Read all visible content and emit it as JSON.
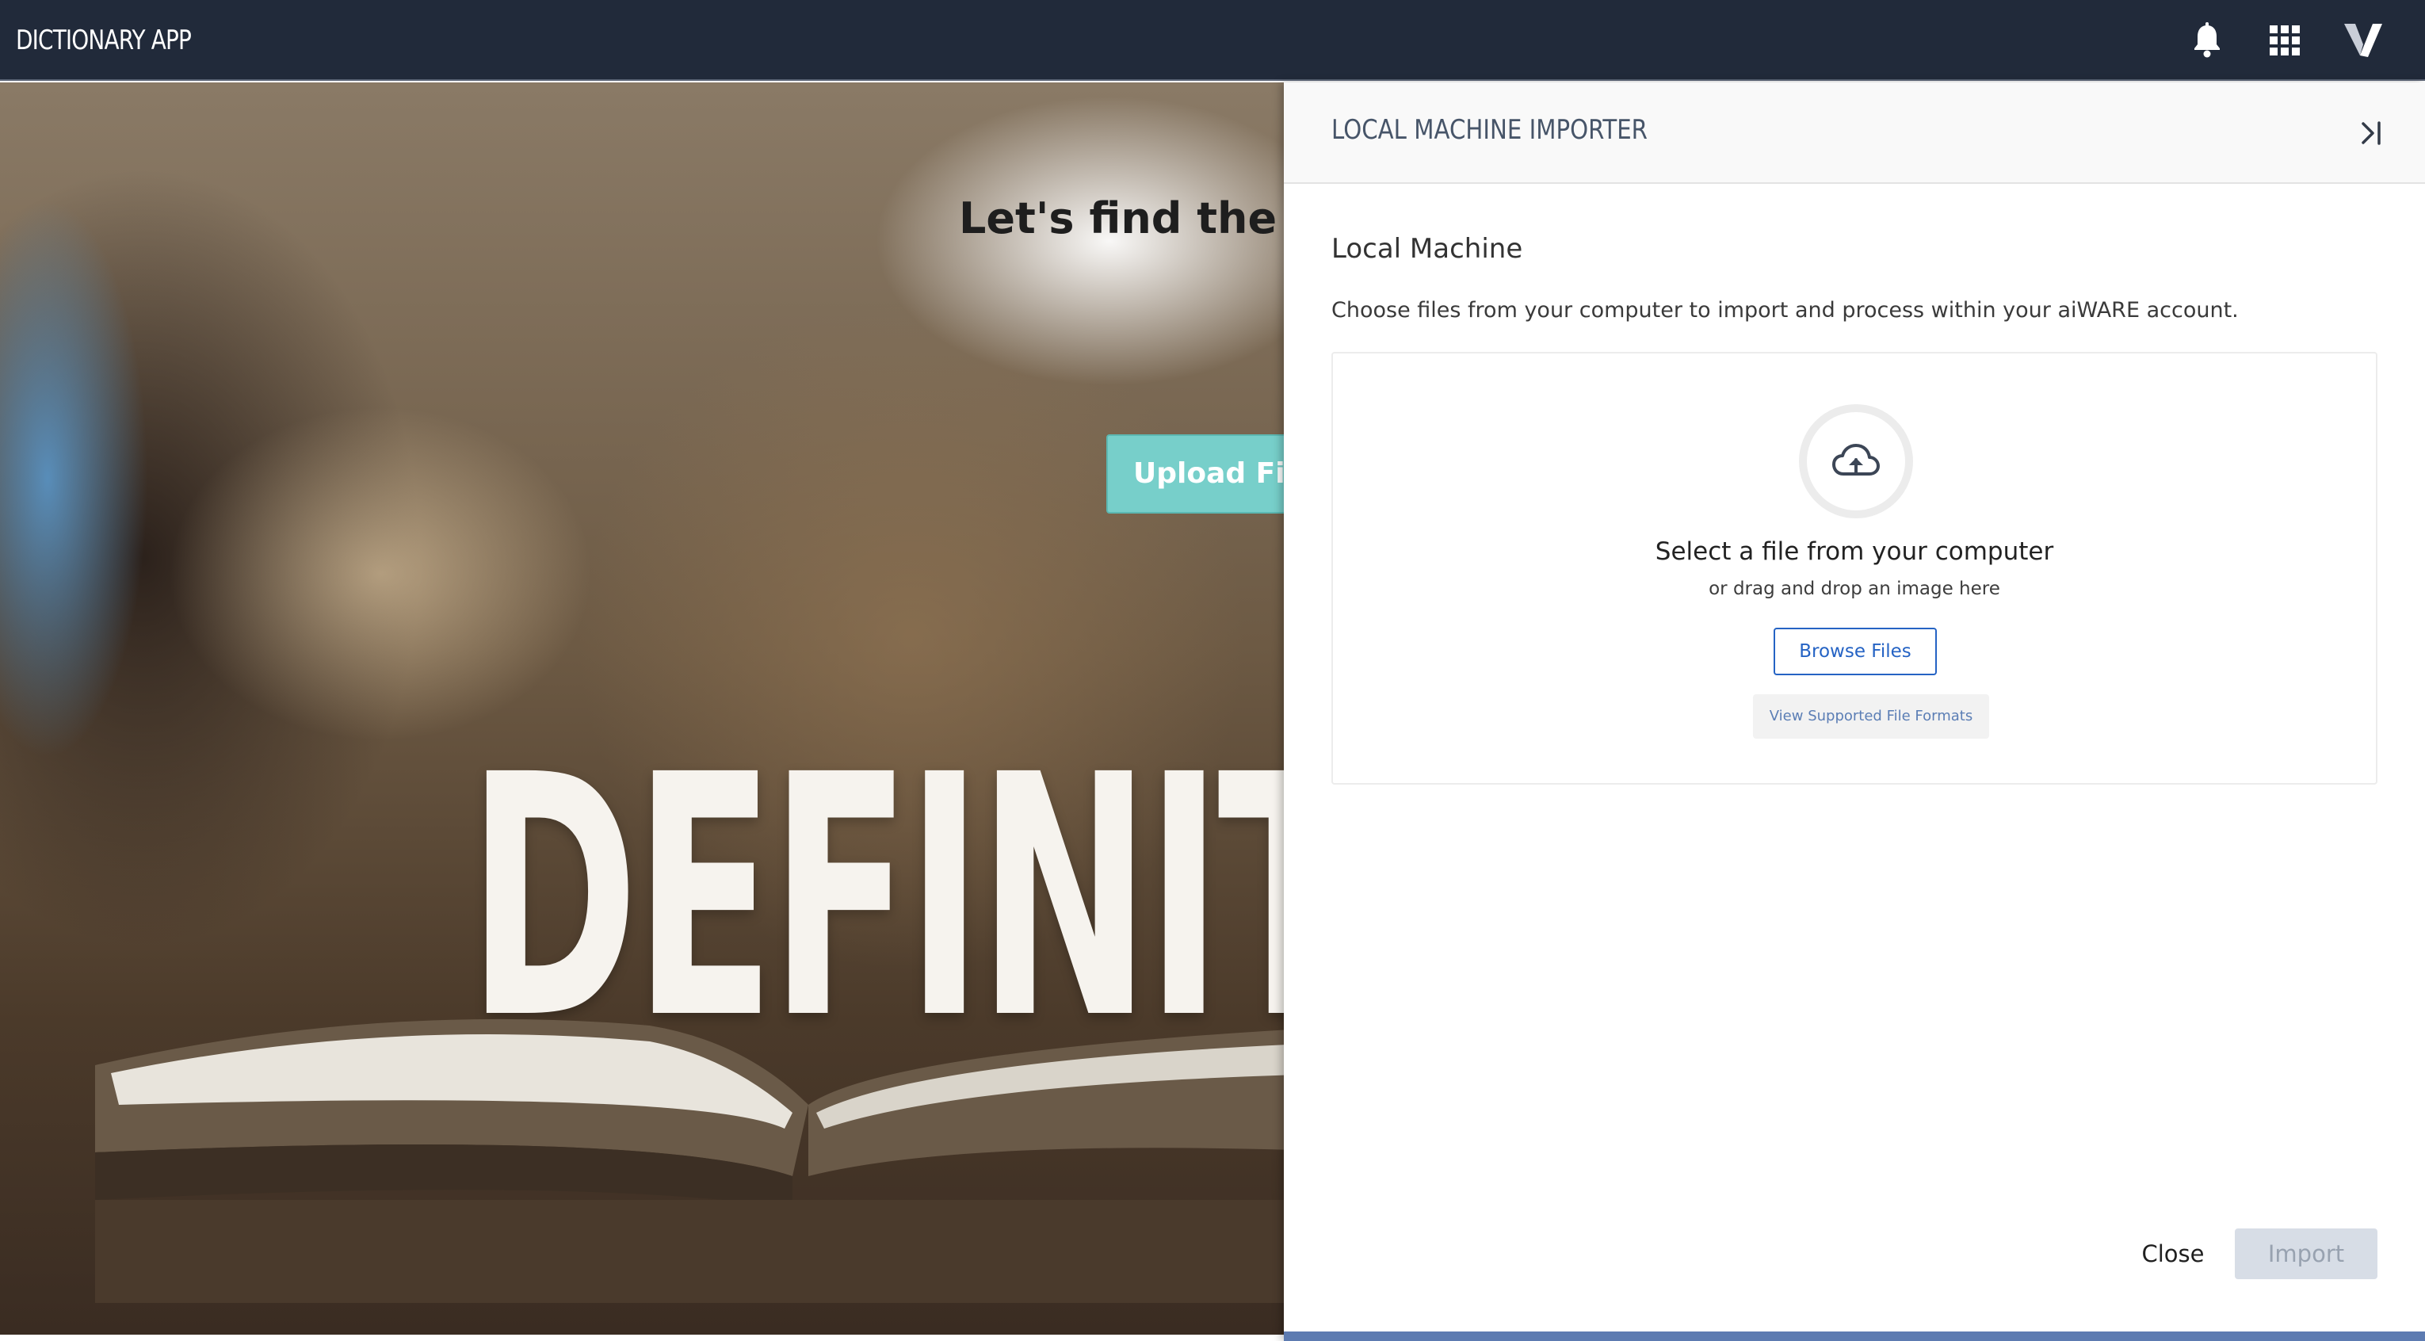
{
  "app": {
    "title": "DICTIONARY APP"
  },
  "topbar": {
    "icons": [
      "bell-icon",
      "apps-grid-icon",
      "brand-logo-icon"
    ]
  },
  "hero": {
    "heading": "Let's find the def",
    "upload_button": "Upload File",
    "background_word": "DEFINITI"
  },
  "drawer": {
    "title": "LOCAL MACHINE IMPORTER",
    "collapse_icon": "collapse-right-icon",
    "section_title": "Local Machine",
    "description": "Choose files from your computer to import and process within your aiWARE account.",
    "dropzone": {
      "icon": "cloud-upload-icon",
      "title": "Select a file from your computer",
      "subtitle": "or drag and drop an image here",
      "browse_label": "Browse Files",
      "formats_label": "View Supported File Formats"
    },
    "footer": {
      "close_label": "Close",
      "import_label": "Import"
    }
  },
  "colors": {
    "topbar": "#212a3a",
    "accent_blue": "#2563c4",
    "upload_teal": "#77cfca",
    "import_disabled": "#d7dde6",
    "footer_bar": "#5d7bb1"
  }
}
